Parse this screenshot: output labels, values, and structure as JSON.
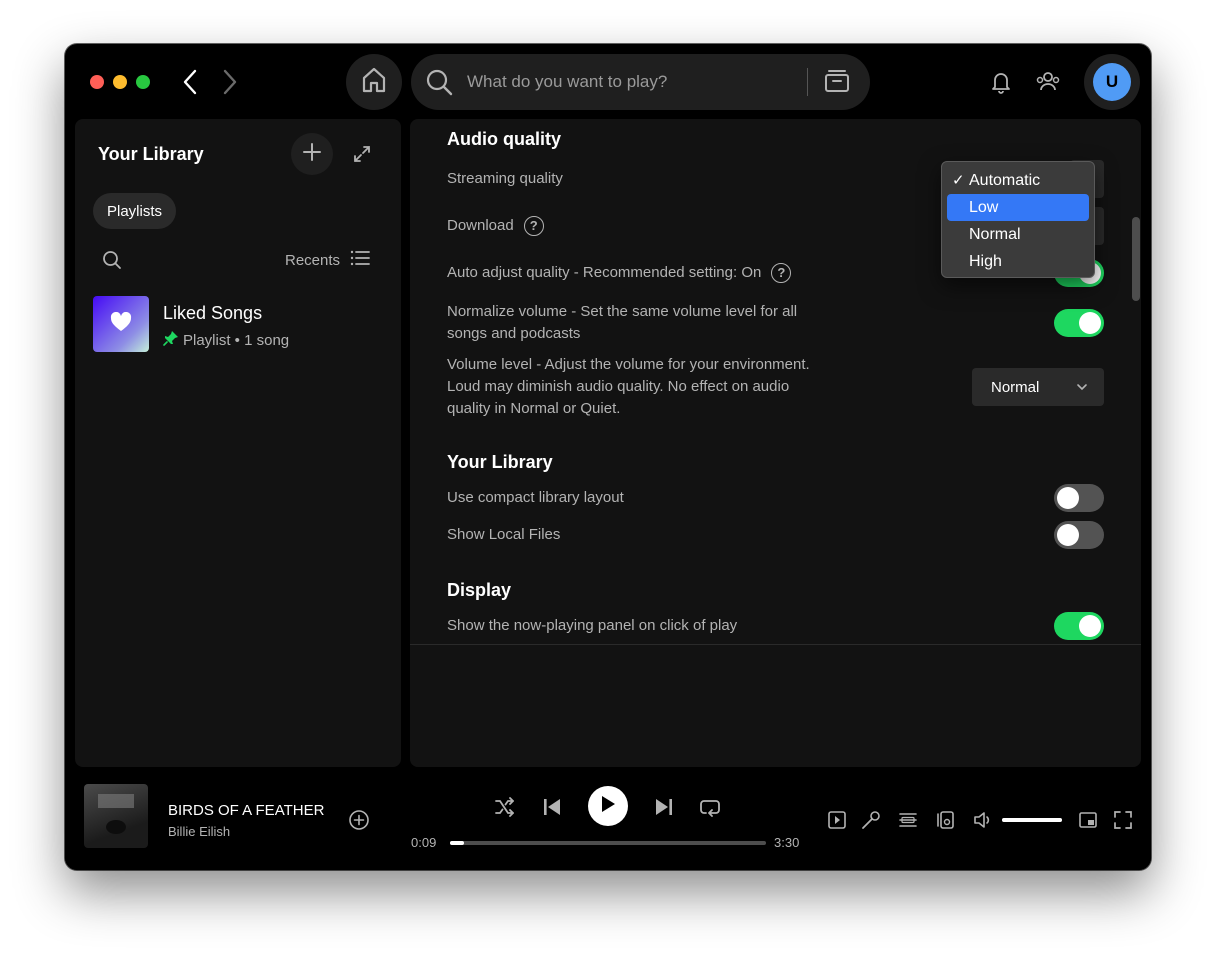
{
  "topbar": {
    "search_placeholder": "What do you want to play?",
    "avatar_initial": "U"
  },
  "library": {
    "title": "Your Library",
    "filter_chip": "Playlists",
    "sort_label": "Recents",
    "items": [
      {
        "title": "Liked Songs",
        "subtitle": "Playlist • 1 song",
        "pinned": true
      }
    ]
  },
  "settings": {
    "sections": {
      "audio_quality": {
        "heading": "Audio quality",
        "streaming_quality": "Streaming quality",
        "download": "Download",
        "auto_adjust": "Auto adjust quality - Recommended setting: On",
        "normalize_line1": "Normalize volume - Set the same volume level for all",
        "normalize_line2": "songs and podcasts",
        "volume_level_line1": "Volume level - Adjust the volume for your environment.",
        "volume_level_line2": "Loud may diminish audio quality. No effect on audio",
        "volume_level_line3": "quality in Normal or Quiet.",
        "volume_level_value": "Normal",
        "auto_adjust_on": true,
        "normalize_on": true
      },
      "your_library": {
        "heading": "Your Library",
        "compact_layout": "Use compact library layout",
        "show_local_files": "Show Local Files",
        "compact_layout_on": false,
        "show_local_files_on": false
      },
      "display": {
        "heading": "Display",
        "now_playing_panel": "Show the now-playing panel on click of play",
        "now_playing_panel_on": true
      }
    },
    "dropdown": {
      "options": [
        "Automatic",
        "Low",
        "Normal",
        "High"
      ],
      "checked": "Automatic",
      "highlighted": "Low",
      "check_glyph": "✓"
    }
  },
  "player": {
    "track_title": "BIRDS OF A FEATHER",
    "artist": "Billie Eilish",
    "elapsed": "0:09",
    "duration": "3:30",
    "progress_fraction": 0.043,
    "volume_fraction": 1.0
  },
  "colors": {
    "accent_green": "#1ed760",
    "highlight_blue": "#3478f6",
    "avatar_blue": "#509bf5",
    "panel_bg": "#121212"
  }
}
